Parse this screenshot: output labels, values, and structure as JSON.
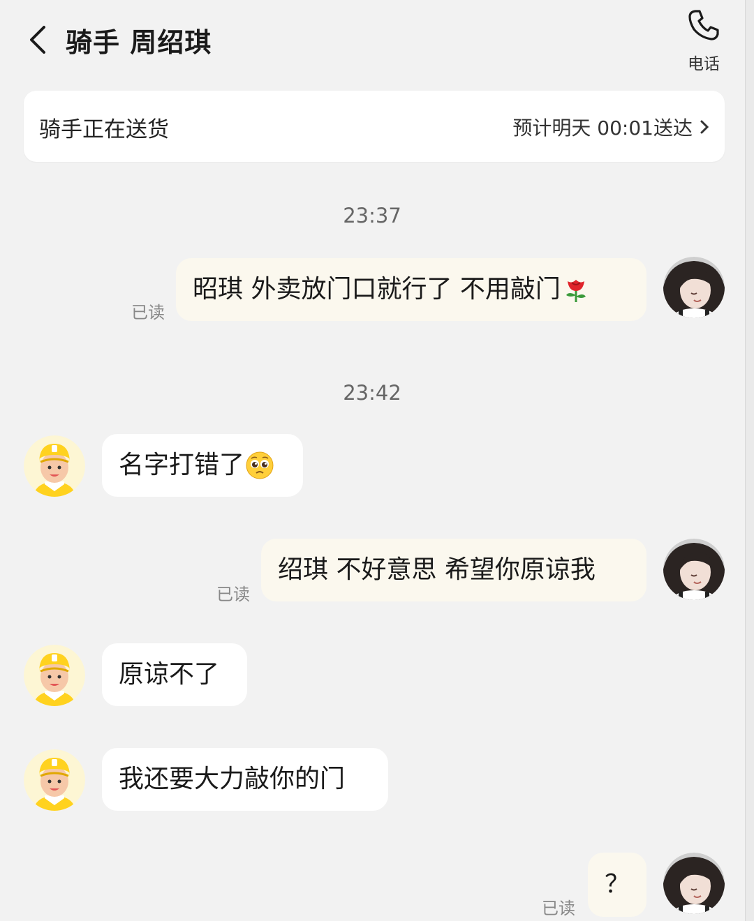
{
  "header": {
    "title": "骑手 周绍琪",
    "call_label": "电话"
  },
  "status": {
    "text": "骑手正在送货",
    "eta": "预计明天 00:01送达"
  },
  "messages": [
    {
      "time": "23:37"
    },
    {
      "side": "out",
      "text": "昭琪 外卖放门口就行了 不用敲门",
      "emoji": "rose-icon",
      "read": "已读"
    },
    {
      "time": "23:42"
    },
    {
      "side": "in",
      "text": "名字打错了",
      "emoji": "pleading-face-icon"
    },
    {
      "side": "out",
      "text": "绍琪 不好意思 希望你原谅我",
      "read": "已读"
    },
    {
      "side": "in",
      "text": "原谅不了"
    },
    {
      "side": "in",
      "text": "我还要大力敲你的门"
    },
    {
      "side": "out",
      "text": "？",
      "read": "已读"
    }
  ],
  "colors": {
    "background": "#f2f2f2",
    "outgoing_bubble": "#fbf8ee",
    "incoming_bubble": "#ffffff",
    "rider_helmet": "#ffd21f"
  }
}
